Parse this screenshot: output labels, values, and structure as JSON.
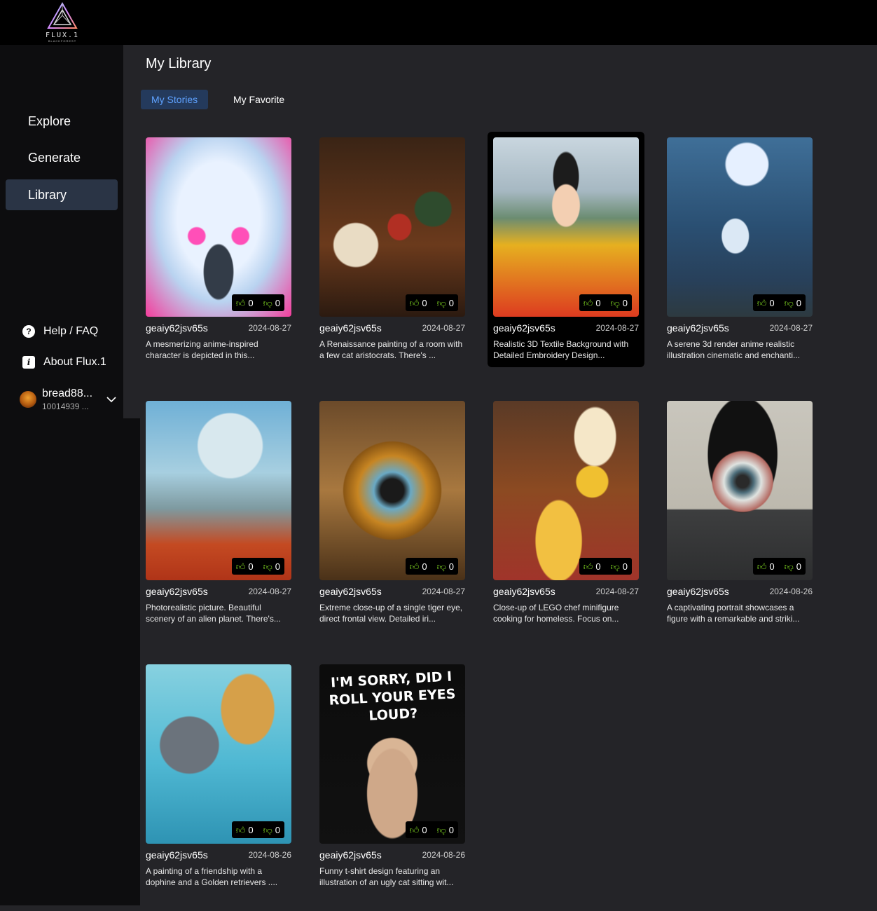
{
  "app": {
    "logo_text": "FLUX.1",
    "logo_sub": "BLACKFOREST"
  },
  "sidebar": {
    "nav": [
      {
        "label": "Explore",
        "active": false
      },
      {
        "label": "Generate",
        "active": false
      },
      {
        "label": "Library",
        "active": true
      }
    ],
    "help": [
      {
        "label": "Help / FAQ",
        "icon": "question-circle-icon",
        "glyph": "?"
      },
      {
        "label": "About Flux.1",
        "icon": "info-square-icon",
        "glyph": "i"
      }
    ],
    "user": {
      "name": "bread88...",
      "id": "10014939 ..."
    }
  },
  "main": {
    "title": "My Library",
    "tabs": [
      {
        "label": "My Stories",
        "active": true
      },
      {
        "label": "My Favorite",
        "active": false
      }
    ],
    "cards": [
      {
        "author": "geaiy62jsv65s",
        "date": "2024-08-27",
        "likes": "0",
        "dislikes": "0",
        "desc": "A mesmerizing anime-inspired character is depicted in this...",
        "selected": false
      },
      {
        "author": "geaiy62jsv65s",
        "date": "2024-08-27",
        "likes": "0",
        "dislikes": "0",
        "desc": "A Renaissance painting of a room with a few cat aristocrats. There's ...",
        "selected": false
      },
      {
        "author": "geaiy62jsv65s",
        "date": "2024-08-27",
        "likes": "0",
        "dislikes": "0",
        "desc": "Realistic 3D Textile Background with Detailed Embroidery Design...",
        "selected": true
      },
      {
        "author": "geaiy62jsv65s",
        "date": "2024-08-27",
        "likes": "0",
        "dislikes": "0",
        "desc": "A serene 3d render anime realistic illustration cinematic and enchanti...",
        "selected": false
      },
      {
        "author": "geaiy62jsv65s",
        "date": "2024-08-27",
        "likes": "0",
        "dislikes": "0",
        "desc": "Photorealistic picture. Beautiful scenery of an alien planet. There's...",
        "selected": false
      },
      {
        "author": "geaiy62jsv65s",
        "date": "2024-08-27",
        "likes": "0",
        "dislikes": "0",
        "desc": "Extreme close-up of a single tiger eye, direct frontal view. Detailed iri...",
        "selected": false
      },
      {
        "author": "geaiy62jsv65s",
        "date": "2024-08-27",
        "likes": "0",
        "dislikes": "0",
        "desc": "Close-up of LEGO chef minifigure cooking for homeless. Focus on...",
        "selected": false
      },
      {
        "author": "geaiy62jsv65s",
        "date": "2024-08-26",
        "likes": "0",
        "dislikes": "0",
        "desc": "A captivating portrait showcases a figure with a remarkable and striki...",
        "selected": false
      },
      {
        "author": "geaiy62jsv65s",
        "date": "2024-08-26",
        "likes": "0",
        "dislikes": "0",
        "desc": "A painting of a friendship with a dophine and a Golden retrievers ....",
        "selected": false
      },
      {
        "author": "geaiy62jsv65s",
        "date": "2024-08-26",
        "likes": "0",
        "dislikes": "0",
        "desc": "Funny t-shirt design featuring an illustration of an ugly cat sitting wit...",
        "selected": false,
        "overlay_text": [
          "I'M SORRY, DID I",
          "ROLL YOUR EYES",
          "LOUD?"
        ]
      }
    ]
  },
  "colors": {
    "accent": "#5fa2ff",
    "like": "#7ed321",
    "active_nav": "#2a3445"
  }
}
